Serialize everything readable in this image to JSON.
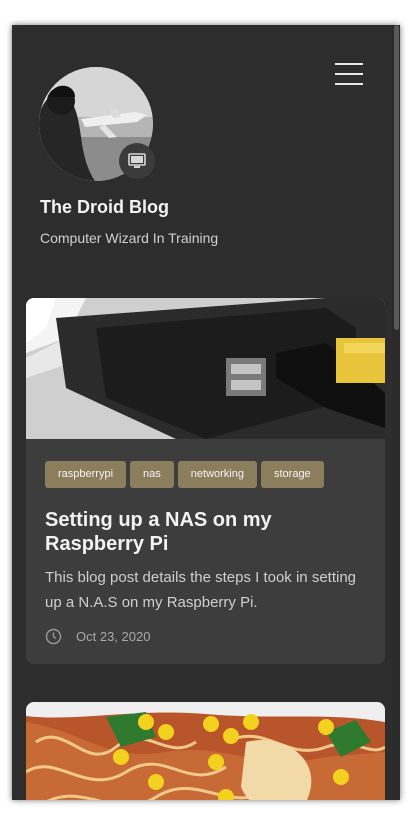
{
  "header": {
    "title": "The Droid Blog",
    "subtitle": "Computer Wizard In Training",
    "menu_icon": "hamburger-icon",
    "avatar_badge_icon": "monitor-icon"
  },
  "posts": [
    {
      "image": "raspberry-pi-photo",
      "tags": [
        "raspberrypi",
        "nas",
        "networking",
        "storage"
      ],
      "title": "Setting up a NAS on my Raspberry Pi",
      "excerpt": "This blog post details the steps I took in setting up a N.A.S on my Raspberry Pi.",
      "date": "Oct 23, 2020",
      "date_icon": "clock-icon"
    },
    {
      "image": "noodle-soup-photo"
    }
  ],
  "colors": {
    "background": "#2d2d2d",
    "card": "#3d3d3d",
    "tag": "#8b7e5c",
    "text": "#f2f2f2"
  }
}
